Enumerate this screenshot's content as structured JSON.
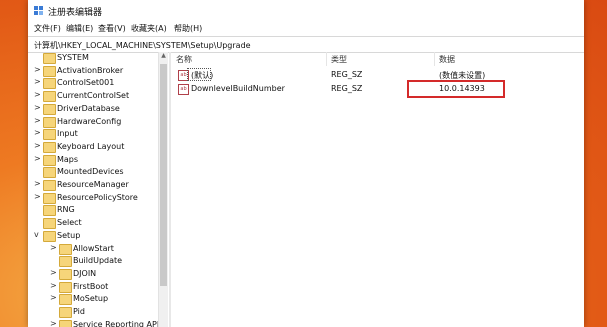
{
  "window": {
    "title": "注册表编辑器"
  },
  "menu": [
    "文件(F)",
    "编辑(E)",
    "查看(V)",
    "收藏夹(A)",
    "帮助(H)"
  ],
  "address": "计算机\\HKEY_LOCAL_MACHINE\\SYSTEM\\Setup\\Upgrade",
  "tree": [
    {
      "label": "SYSTEM",
      "indent": 0,
      "arrow": ""
    },
    {
      "label": "ActivationBroker",
      "indent": 0,
      "arrow": ">"
    },
    {
      "label": "ControlSet001",
      "indent": 0,
      "arrow": ">"
    },
    {
      "label": "CurrentControlSet",
      "indent": 0,
      "arrow": ">"
    },
    {
      "label": "DriverDatabase",
      "indent": 0,
      "arrow": ">"
    },
    {
      "label": "HardwareConfig",
      "indent": 0,
      "arrow": ">"
    },
    {
      "label": "Input",
      "indent": 0,
      "arrow": ">"
    },
    {
      "label": "Keyboard Layout",
      "indent": 0,
      "arrow": ">"
    },
    {
      "label": "Maps",
      "indent": 0,
      "arrow": ">"
    },
    {
      "label": "MountedDevices",
      "indent": 0,
      "arrow": ""
    },
    {
      "label": "ResourceManager",
      "indent": 0,
      "arrow": ">"
    },
    {
      "label": "ResourcePolicyStore",
      "indent": 0,
      "arrow": ">"
    },
    {
      "label": "RNG",
      "indent": 0,
      "arrow": ""
    },
    {
      "label": "Select",
      "indent": 0,
      "arrow": ""
    },
    {
      "label": "Setup",
      "indent": 0,
      "arrow": "v"
    },
    {
      "label": "AllowStart",
      "indent": 1,
      "arrow": ">"
    },
    {
      "label": "BuildUpdate",
      "indent": 1,
      "arrow": ""
    },
    {
      "label": "DJOIN",
      "indent": 1,
      "arrow": ">"
    },
    {
      "label": "FirstBoot",
      "indent": 1,
      "arrow": ">"
    },
    {
      "label": "MoSetup",
      "indent": 1,
      "arrow": ">"
    },
    {
      "label": "Pid",
      "indent": 1,
      "arrow": ""
    },
    {
      "label": "Service Reporting API",
      "indent": 1,
      "arrow": ">"
    }
  ],
  "list": {
    "headers": {
      "name": "名称",
      "type": "类型",
      "data": "数据"
    },
    "rows": [
      {
        "name": "(默认)",
        "type": "REG_SZ",
        "data": "(数值未设置)"
      },
      {
        "name": "DownlevelBuildNumber",
        "type": "REG_SZ",
        "data": "10.0.14393"
      }
    ]
  },
  "colors": {
    "highlight": "#d42a2a"
  },
  "icons": {
    "app": "regedit-icon",
    "folder": "folder-icon",
    "value": "string-value-icon"
  }
}
